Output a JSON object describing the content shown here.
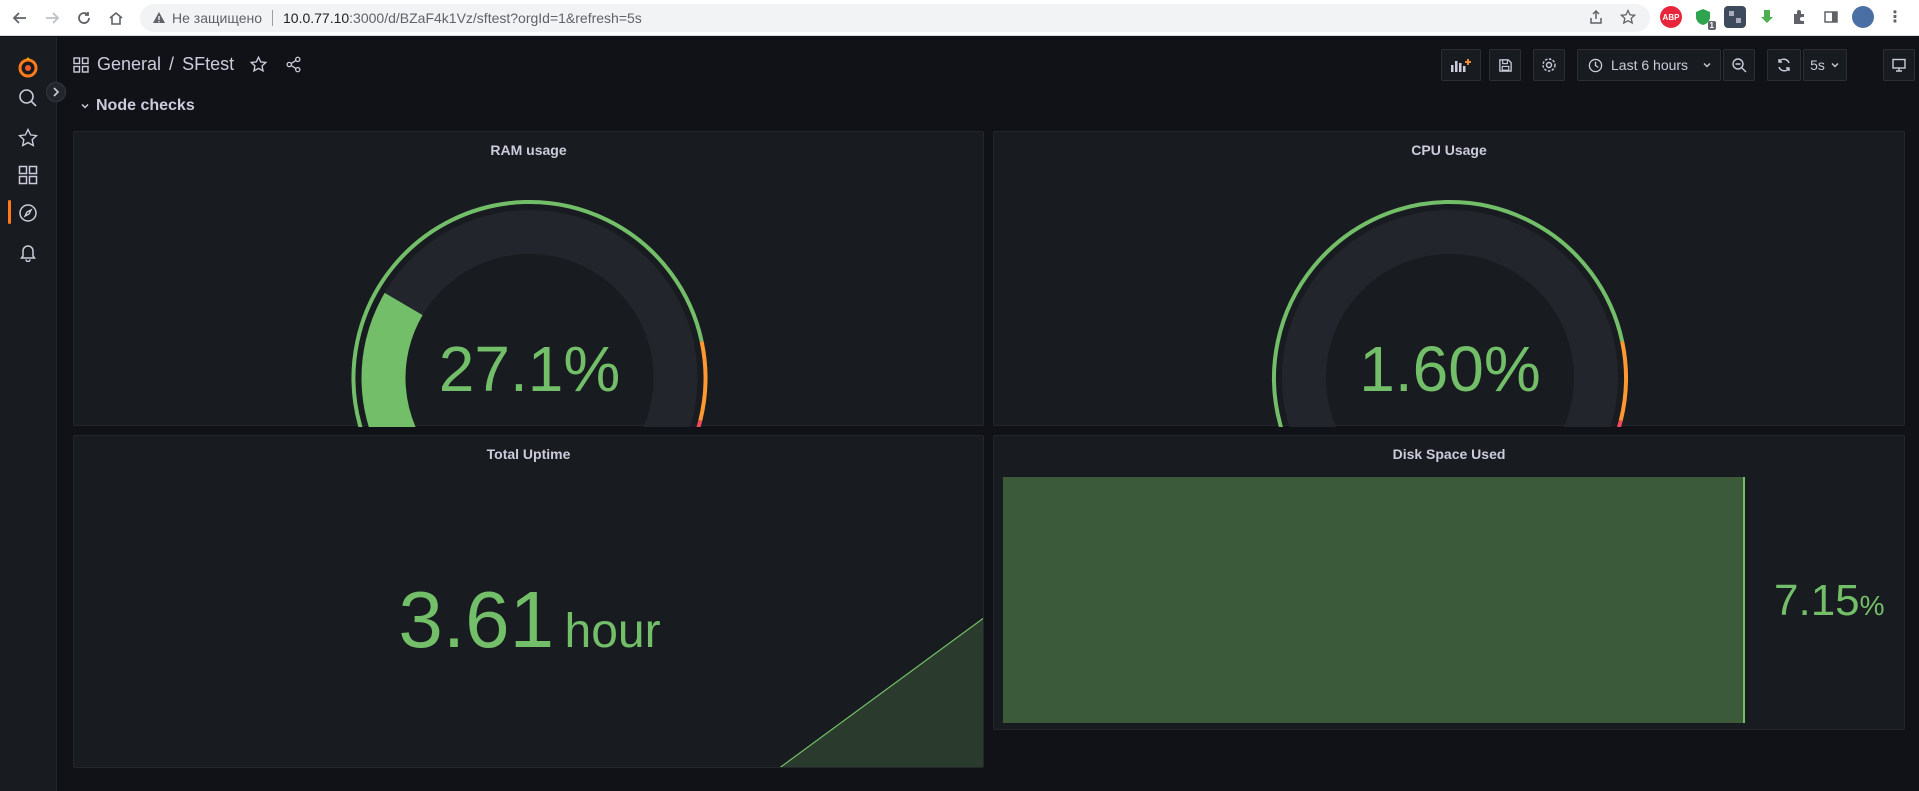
{
  "browser": {
    "security_label": "Не защищено",
    "url_host": "10.0.77.10",
    "url_rest": ":3000/d/BZaF4k1Vz/sftest?orgId=1&refresh=5s",
    "extension_badge": "1",
    "abp_label": "ABP"
  },
  "breadcrumb": {
    "folder": "General",
    "separator": "/",
    "dashboard": "SFtest"
  },
  "toolbar": {
    "time_range": "Last 6 hours",
    "refresh_interval": "5s"
  },
  "row": {
    "title": "Node checks"
  },
  "panels": {
    "ram": {
      "title": "RAM usage",
      "value_text": "27.1%",
      "value": 27.1,
      "min": 0,
      "max": 100,
      "thresholds": [
        80,
        90
      ],
      "color": "#73bf69"
    },
    "cpu": {
      "title": "CPU Usage",
      "value_text": "1.60%",
      "value": 1.6,
      "min": 0,
      "max": 100,
      "thresholds": [
        80,
        90
      ],
      "color": "#73bf69"
    },
    "uptime": {
      "title": "Total Uptime",
      "value_text": "3.61",
      "unit_text": "hour",
      "color": "#73bf69"
    },
    "disk": {
      "title": "Disk Space Used",
      "value_text": "7.15",
      "unit_text": "%",
      "color": "#73bf69"
    }
  },
  "colors": {
    "ok": "#73bf69",
    "warn": "#ff9830",
    "crit": "#f2495c",
    "grafana_orange": "#ff7a1a"
  }
}
